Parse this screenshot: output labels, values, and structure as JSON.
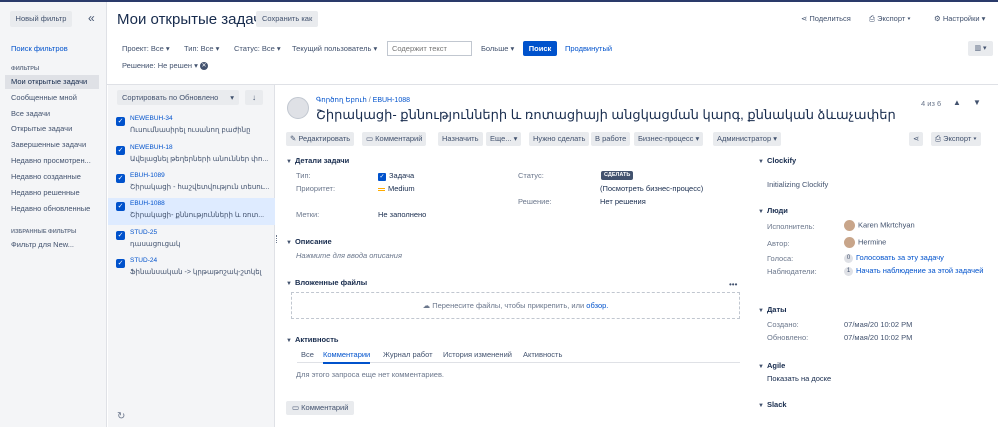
{
  "sidebar": {
    "new_filter": "Новый фильтр",
    "collapse": "«",
    "search_filters": "Поиск фильтров",
    "filters_heading": "ФИЛЬТРЫ",
    "items": [
      "Мои открытые задачи",
      "Сообщенные мной",
      "Все задачи",
      "Открытые задачи",
      "Завершенные задачи",
      "Недавно просмотрен...",
      "Недавно созданные",
      "Недавно решенные",
      "Недавно обновленные"
    ],
    "favorites_heading": "ИЗБРАННЫЕ ФИЛЬТРЫ",
    "favorite": "Фильтр для New..."
  },
  "header": {
    "title": "Мои открытые задачи",
    "save_as": "Сохранить как",
    "share": "Поделиться",
    "export": "Экспорт",
    "settings": "Настройки"
  },
  "filters": {
    "project": "Проект: Все",
    "type": "Тип: Все",
    "status": "Статус: Все",
    "user": "Текущий пользователь",
    "text_placeholder": "Содержит текст",
    "more": "Больше",
    "search": "Поиск",
    "advanced": "Продвинутый",
    "resolution": "Решение: Не решен"
  },
  "list": {
    "sort": "Сортировать по Обновлено",
    "issues": [
      {
        "key": "NEWEBUH-34",
        "summary": "Ուսումնասիրել ուսանող բաժինը"
      },
      {
        "key": "NEWEBUH-18",
        "summary": "Ավելացնել թեղերների անուններ փո..."
      },
      {
        "key": "EBUH-1089",
        "summary": "Շիրակացի - հաշվետվություն տեսու..."
      },
      {
        "key": "EBUH-1088",
        "summary": "Շիրակացի- քննությունների և ռոտ..."
      },
      {
        "key": "STUD-25",
        "summary": "դասացուցակ"
      },
      {
        "key": "STUD-24",
        "summary": "Ֆինանսական -> կրթաթոշակ-շտկել"
      }
    ]
  },
  "issue": {
    "breadcrumb_project": "Գործող Եբուհ",
    "breadcrumb_key": "EBUH-1088",
    "title": "Շիրակացի- քննությունների և ռոտացիայի անցկացման կարգ, քննական ձևաչափեր",
    "position": "4 из 6",
    "toolbar": [
      "Редактировать",
      "Комментарий",
      "Назначить",
      "Еще...",
      "Нужно сделать",
      "В работе",
      "Бизнес-процесс",
      "Администратор"
    ],
    "export": "Экспорт",
    "details_heading": "Детали задачи",
    "type_label": "Тип:",
    "type_value": "Задача",
    "priority_label": "Приоритет:",
    "priority_value": "Medium",
    "labels_label": "Метки:",
    "labels_value": "Не заполнено",
    "status_label": "Статус:",
    "status_value": "СДЕЛАТЬ",
    "workflow_link": "(Посмотреть бизнес-процесс)",
    "resolution_label": "Решение:",
    "resolution_value": "Нет решения",
    "description_heading": "Описание",
    "description_hint": "Нажмите для ввода описания",
    "attachments_heading": "Вложенные файлы",
    "attachments_hint": "Перенесите файлы, чтобы прикрепить, или",
    "attachments_link": "обзор.",
    "activity_heading": "Активность",
    "tabs": [
      "Все",
      "Комментарии",
      "Журнал работ",
      "История изменений",
      "Активность"
    ],
    "no_comments": "Для этого запроса еще нет комментариев.",
    "comment_button": "Комментарий"
  },
  "right": {
    "clockify_heading": "Clockify",
    "clockify_text": "Initializing Clockify",
    "people_heading": "Люди",
    "assignee_label": "Исполнитель:",
    "assignee": "Karen Mkrtchyan",
    "reporter_label": "Автор:",
    "reporter": "Hermine",
    "votes_label": "Голоса:",
    "votes_count": "0",
    "votes_link": "Голосовать за эту задачу",
    "watchers_label": "Наблюдатели:",
    "watchers_count": "1",
    "watchers_link": "Начать наблюдение за этой задачей",
    "dates_heading": "Даты",
    "created_label": "Создано:",
    "created": "07/мая/20 10:02 PM",
    "updated_label": "Обновлено:",
    "updated": "07/мая/20 10:02 PM",
    "agile_heading": "Agile",
    "agile_link": "Показать на доске",
    "slack_heading": "Slack"
  }
}
